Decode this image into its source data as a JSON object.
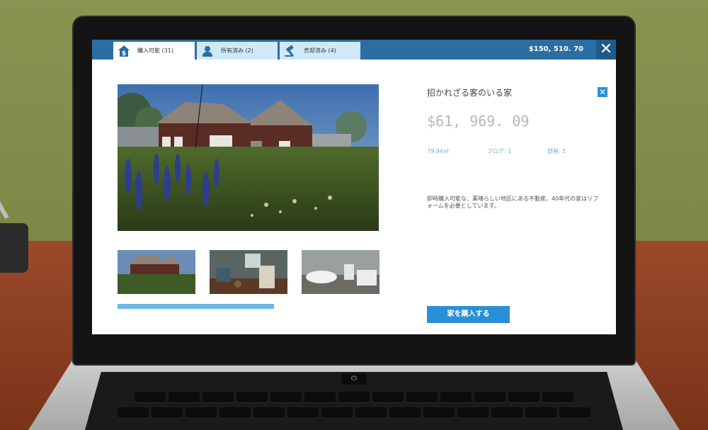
{
  "tabs": [
    {
      "label": "購入可能 (31)",
      "icon": "house-dollar-icon"
    },
    {
      "label": "所有済み (2)",
      "icon": "person-icon"
    },
    {
      "label": "売却済み (4)",
      "icon": "gavel-icon"
    }
  ],
  "balance": "$150, 510. 70",
  "close_main_glyph": "✕",
  "house": {
    "title": "招かれざる客のいる家",
    "price": "$61, 969. 09",
    "area": "79.94㎡",
    "floors": "フロア: 1",
    "rooms": "部屋: 5",
    "description": "即時購入可能な、素晴らしい地区にある不動産。40年代の家はリフォームを必要としています。",
    "buy_label": "家を購入する",
    "close_glyph": "✕"
  },
  "gallery": {
    "progress": 0.6,
    "thumbnails": [
      "house-exterior",
      "bedroom",
      "bathroom"
    ]
  },
  "colors": {
    "topbar": "#2b6ea3",
    "accent": "#2a8fd6",
    "tab_inactive": "#cfe9f8",
    "progress": "#6bb7ea"
  }
}
